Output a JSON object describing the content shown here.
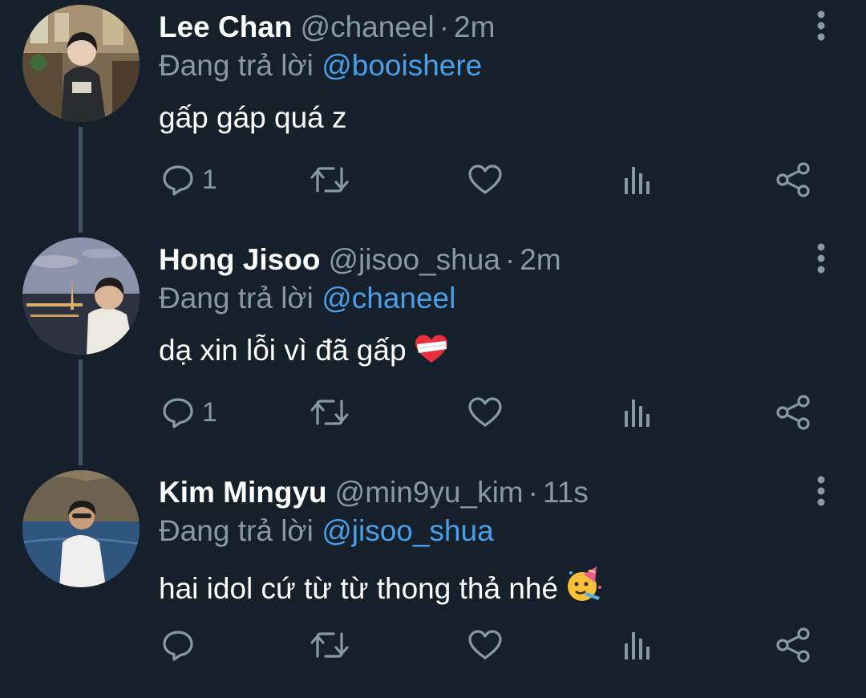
{
  "colors": {
    "background": "#15202b",
    "secondary_text": "#8899a6",
    "mention": "#4a9fe8",
    "thread_line": "#3d5466",
    "icon": "#8899a6"
  },
  "tweets": [
    {
      "display_name": "Lee Chan",
      "handle": "@chaneel",
      "separator": "·",
      "time": "2m",
      "replying_label": "Đang trả lời",
      "replying_to": "@booishere",
      "text": "gấp gáp quá z",
      "emoji": "",
      "reply_count": "1",
      "avatar_icon": "avatar-lee-chan"
    },
    {
      "display_name": "Hong Jisoo",
      "handle": "@jisoo_shua",
      "separator": "·",
      "time": "2m",
      "replying_label": "Đang trả lời",
      "replying_to": "@chaneel",
      "text": "dạ xin lỗi vì đã gấp",
      "emoji": "mending-heart-emoji",
      "reply_count": "1",
      "avatar_icon": "avatar-hong-jisoo"
    },
    {
      "display_name": "Kim Mingyu",
      "handle": "@min9yu_kim",
      "separator": "·",
      "time": "11s",
      "replying_label": "Đang trả lời",
      "replying_to": "@jisoo_shua",
      "text": "hai idol cứ từ từ thong thả nhé",
      "emoji": "partying-face-emoji",
      "reply_count": "",
      "avatar_icon": "avatar-kim-mingyu"
    }
  ]
}
